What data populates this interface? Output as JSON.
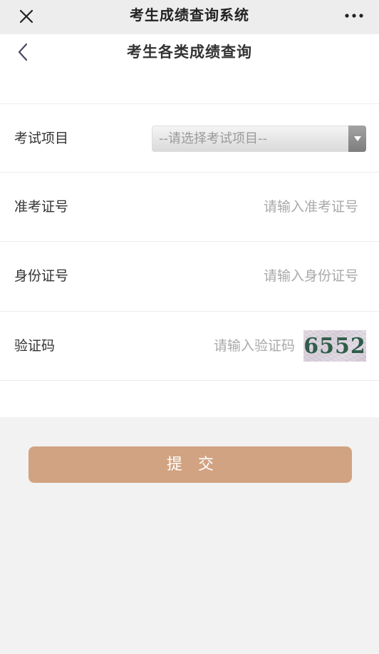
{
  "app": {
    "title": "考生成绩查询系统"
  },
  "page": {
    "title": "考生各类成绩查询"
  },
  "form": {
    "exam_item": {
      "label": "考试项目",
      "selected": "--请选择考试项目--"
    },
    "ticket_number": {
      "label": "准考证号",
      "placeholder": "请输入准考证号"
    },
    "id_number": {
      "label": "身份证号",
      "placeholder": "请输入身份证号"
    },
    "captcha": {
      "label": "验证码",
      "placeholder": "请输入验证码",
      "image_text": "6552"
    },
    "submit_label": "提交"
  },
  "icons": {
    "close": "close-icon",
    "more": "more-icon",
    "back": "chevron-left-icon",
    "dropdown": "triangle-down-icon"
  },
  "colors": {
    "top_bar_bg": "#ededed",
    "page_bg": "#f2f2f2",
    "card_bg": "#ffffff",
    "submit_bg": "#d1a382",
    "placeholder_text": "#a9a9a9"
  }
}
